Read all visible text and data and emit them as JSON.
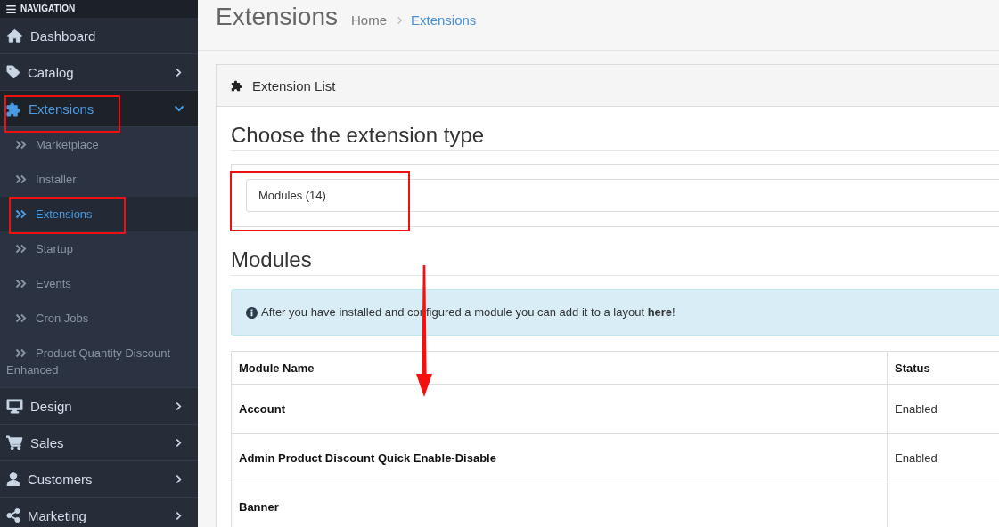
{
  "sidebar": {
    "title": "NAVIGATION",
    "items": [
      {
        "label": "Dashboard",
        "kind": "link",
        "selected": false,
        "highlighted": false
      },
      {
        "label": "Catalog",
        "kind": "menu",
        "expanded": false,
        "selected": false,
        "highlighted": false
      },
      {
        "label": "Extensions",
        "kind": "menu",
        "expanded": true,
        "selected": true,
        "highlighted": true,
        "children": [
          {
            "label": "Marketplace",
            "selected": false,
            "highlighted": false
          },
          {
            "label": "Installer",
            "selected": false,
            "highlighted": false
          },
          {
            "label": "Extensions",
            "selected": true,
            "highlighted": true
          },
          {
            "label": "Startup",
            "selected": false,
            "highlighted": false
          },
          {
            "label": "Events",
            "selected": false,
            "highlighted": false
          },
          {
            "label": "Cron Jobs",
            "selected": false,
            "highlighted": false
          },
          {
            "label": "Product Quantity Discount Enhanced",
            "selected": false,
            "highlighted": false
          }
        ]
      },
      {
        "label": "Design",
        "kind": "menu",
        "expanded": false,
        "selected": false,
        "highlighted": false
      },
      {
        "label": "Sales",
        "kind": "menu",
        "expanded": false,
        "selected": false,
        "highlighted": false
      },
      {
        "label": "Customers",
        "kind": "menu",
        "expanded": false,
        "selected": false,
        "highlighted": false
      },
      {
        "label": "Marketing",
        "kind": "menu",
        "expanded": false,
        "selected": false,
        "highlighted": false
      }
    ]
  },
  "header": {
    "title": "Extensions",
    "breadcrumb": [
      {
        "label": "Home",
        "current": false
      },
      {
        "label": "Extensions",
        "current": true
      }
    ]
  },
  "panel": {
    "title": "Extension List",
    "type_section": {
      "heading": "Choose the extension type",
      "select": {
        "value": "Modules (14)",
        "highlighted": true
      }
    },
    "modules_section": {
      "heading": "Modules",
      "annotation_arrow": true,
      "alert": "After you have installed and configured a module you can add it to a layout **here**!",
      "table": {
        "columns": [
          "Module Name",
          "Status"
        ],
        "rows": [
          {
            "name": "Account",
            "status": "Enabled"
          },
          {
            "name": "Admin Product Discount Quick Enable-Disable",
            "status": "Enabled"
          },
          {
            "name": "Banner"
          }
        ]
      }
    }
  }
}
